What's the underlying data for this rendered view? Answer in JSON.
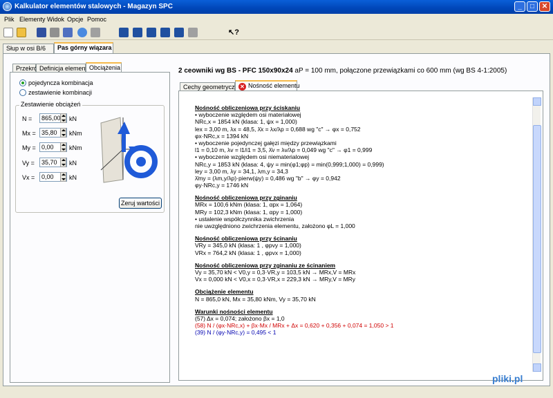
{
  "window": {
    "title": "Kalkulator elementów stalowych - Magazyn SPC"
  },
  "menu": [
    "Plik",
    "Elementy",
    "Widok",
    "Opcje",
    "Pomoc"
  ],
  "top_tabs": [
    "Słup w osi B/6",
    "Pas górny wiązara"
  ],
  "left_tabs": [
    "Przekrój",
    "Definicja elementu",
    "Obciążenia"
  ],
  "radios": {
    "single": "pojedyncza kombinacja",
    "set": "zestawienie kombinacji"
  },
  "loads": {
    "group_label": "Zestawienie obciążeń",
    "rows": [
      {
        "label": "N =",
        "value": "865,00",
        "unit": "kN"
      },
      {
        "label": "Mx =",
        "value": "35,80",
        "unit": "kNm"
      },
      {
        "label": "My =",
        "value": "0,00",
        "unit": "kNm"
      },
      {
        "label": "Vy =",
        "value": "35,70",
        "unit": "kN"
      },
      {
        "label": "Vx =",
        "value": "0,00",
        "unit": "kN"
      }
    ],
    "reset_button": "Zeruj wartości"
  },
  "heading": {
    "bold": "2 ceowniki wg BS - PFC 150x90x24",
    "rest": " aP = 100 mm, połączone przewiązkami co 600 mm (wg BS 4-1:2005)"
  },
  "content_tabs": [
    "Cechy geometryczne",
    "Nośność elementu"
  ],
  "doc": [
    {
      "t": "Nośność obliczeniowa przy ściskaniu",
      "s": "sec"
    },
    {
      "t": "• wyboczenie względem osi materiałowej"
    },
    {
      "t": "NRc,x = 1854 kN  (klasa: 1, ψx = 1,000)"
    },
    {
      "t": "lex = 3,00 m,  λx = 48,5,   λ̄x = λx/λp = 0,688   wg \"c\" → φx = 0,752"
    },
    {
      "t": "φx·NRc,x = 1394 kN"
    },
    {
      "t": "• wyboczenie pojedynczej gałęzi między przewiązkami"
    },
    {
      "t": "l1 = 0,10 m,   λv = l1/i1 = 3,5,    λ̄v = λv/λp = 0,049   wg \"c\" → φ1 = 0,999"
    },
    {
      "t": "• wyboczenie względem osi niematerialowej"
    },
    {
      "t": "NRc,y = 1853 kN  (klasa: 4, ψy = min(φ1;φp) = min(0,999;1,000) = 0,999)"
    },
    {
      "t": "ley = 3,00 m,  λy = 34,1,  λm,y = 34,3"
    },
    {
      "t": "λ̄my = (λm,y/λp)·pierw(ψy) = 0,486   wg \"b\" → φy = 0,942"
    },
    {
      "t": "φy·NRc,y = 1746 kN"
    },
    {
      "t": "Nośność obliczeniowa przy zginaniu",
      "s": "sec"
    },
    {
      "t": "MRx = 100,6 kNm  (klasa: 1, αpx = 1,064)"
    },
    {
      "t": "MRy = 102,3 kNm  (klasa: 1, αpy = 1,000)"
    },
    {
      "t": "• ustalenie współczynnika zwichrzenia"
    },
    {
      "t": "nie uwzględniono zwichrzenia elementu, założono φL = 1,000"
    },
    {
      "t": "Nośność obliczeniowa przy ścinaniu",
      "s": "sec"
    },
    {
      "t": "VRy = 345,0 kN  (klasa: 1 , φpvy = 1,000)"
    },
    {
      "t": "VRx = 764,2 kN  (klasa: 1 , φpvx = 1,000)"
    },
    {
      "t": "Nośność obliczeniowa przy zginaniu ze ścinaniem",
      "s": "sec"
    },
    {
      "t": "Vy = 35,70 kN  <  V0,y = 0,3·VR,y = 103,5 kN  →   MRx,V = MRx"
    },
    {
      "t": "Vx = 0,000 kN  <  V0,x = 0,3·VR,x = 229,3 kN  →   MRy,V = MRy"
    },
    {
      "t": "Obciążenie elementu",
      "s": "sec"
    },
    {
      "t": "N = 865,0 kN,    Mx = 35,80 kNm,    Vy = 35,70 kN"
    },
    {
      "t": "Warunki nośności elementu",
      "s": "sec"
    },
    {
      "t": "(57)   Δx = 0,074;    założono βx = 1,0"
    },
    {
      "t": "(58)   N / (φx·NRc,x) + βx·Mx / MRx + Δx = 0,620 + 0,356 + 0,074 = 1,050  >  1",
      "s": "red"
    },
    {
      "t": "(39)   N / (φy·NRc,y) = 0,495  <  1",
      "s": "blue"
    }
  ],
  "watermark": "pliki.pl"
}
